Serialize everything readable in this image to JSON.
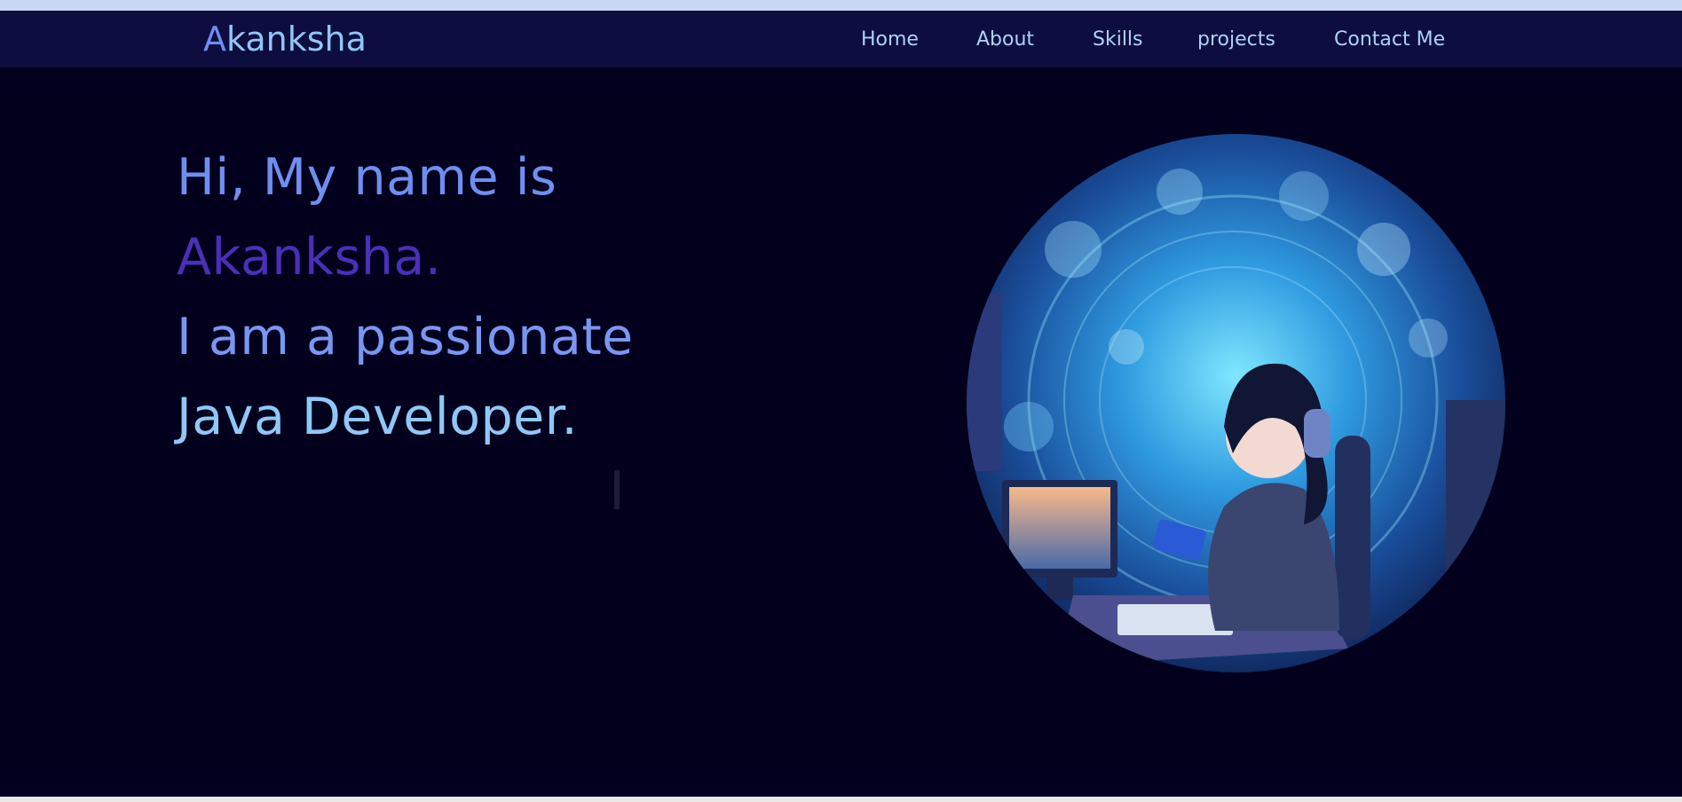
{
  "nav": {
    "brand_first": "A",
    "brand_rest": "kanksha",
    "links": [
      "Home",
      "About",
      "Skills",
      "projects",
      "Contact Me"
    ]
  },
  "hero": {
    "line1": "Hi, My name is",
    "line2": "Akanksha.",
    "line3": "I am a passionate",
    "line4": "Java Developer."
  },
  "colors": {
    "nav_bg": "#0e0d3f",
    "hero_bg": "#02001d",
    "accent_blue": "#6f8ff0",
    "accent_purple": "#4a2fb8",
    "accent_light": "#8fc8f7"
  },
  "image": {
    "subject": "illustration-girl-with-headphones-at-computer"
  }
}
